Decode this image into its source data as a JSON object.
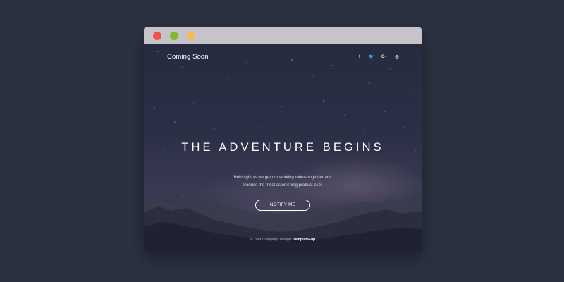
{
  "browser": {
    "buttons": [
      "close",
      "minimize",
      "maximize"
    ],
    "colors": {
      "close": "#f3504b",
      "minimize": "#84b827",
      "maximize": "#f6bb52",
      "titlebar": "#c4c4c9"
    }
  },
  "page": {
    "brand": "Coming Soon",
    "social": [
      {
        "name": "facebook-icon",
        "glyph": "f"
      },
      {
        "name": "twitter-icon",
        "glyph": "🐦"
      },
      {
        "name": "google-plus-icon",
        "glyph": "G+"
      },
      {
        "name": "instagram-icon",
        "glyph": "◎"
      }
    ],
    "headline": "THE ADVENTURE BEGINS",
    "subtext": {
      "line1": "Hold tight as we get our working robots together and",
      "line2": "produce the most astonishing product ever."
    },
    "cta": "NOTIFY ME",
    "footer": {
      "prefix": "© Your Company, Design: ",
      "credit": "TemplateFlip"
    }
  },
  "colors": {
    "background": "#2b3140",
    "text": "#ffffff"
  }
}
